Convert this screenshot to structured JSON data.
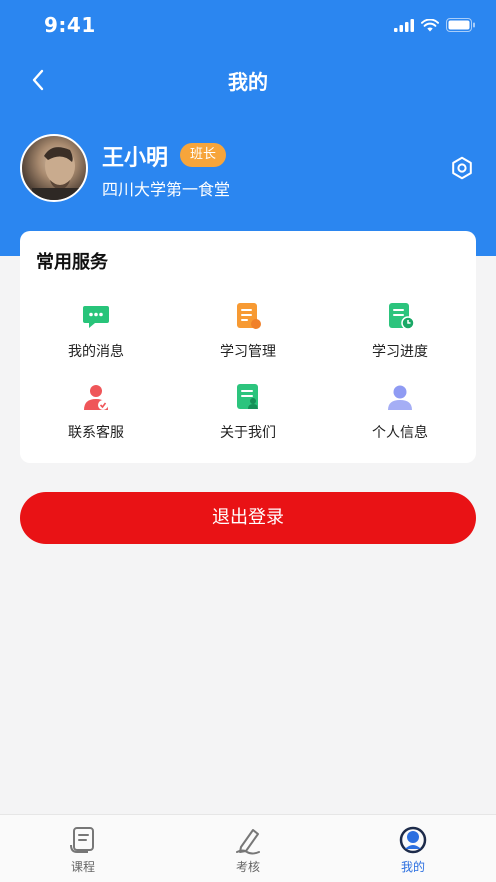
{
  "status_bar": {
    "time": "9:41"
  },
  "header": {
    "title": "我的",
    "back_icon": "chevron-left-icon"
  },
  "profile": {
    "name": "王小明",
    "badge": "班长",
    "organization": "四川大学第一食堂",
    "settings_icon": "gear-icon"
  },
  "services": {
    "title": "常用服务",
    "items": [
      {
        "label": "我的消息",
        "icon": "chat-bubble-icon",
        "color": "#28c47a"
      },
      {
        "label": "学习管理",
        "icon": "document-edit-icon",
        "color": "#f79a33"
      },
      {
        "label": "学习进度",
        "icon": "document-clock-icon",
        "color": "#2cc47d"
      },
      {
        "label": "联系客服",
        "icon": "support-user-icon",
        "color": "#ef5659"
      },
      {
        "label": "关于我们",
        "icon": "document-user-icon",
        "color": "#2cc47d"
      },
      {
        "label": "个人信息",
        "icon": "person-icon",
        "color": "#8f9bf3"
      }
    ]
  },
  "logout": {
    "label": "退出登录"
  },
  "tab_bar": {
    "tabs": [
      {
        "label": "课程",
        "icon": "course-scroll-icon",
        "active": false
      },
      {
        "label": "考核",
        "icon": "exam-pen-icon",
        "active": false
      },
      {
        "label": "我的",
        "icon": "profile-icon",
        "active": true
      }
    ],
    "active_color": "#2b6fe0"
  },
  "colors": {
    "primary": "#2b86f0",
    "logout": "#e91215",
    "badge": "#f7a53b"
  }
}
